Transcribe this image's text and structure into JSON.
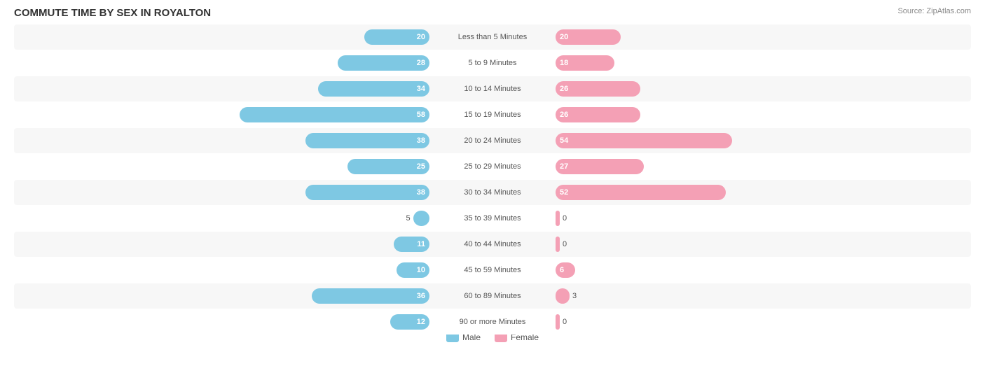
{
  "title": "COMMUTE TIME BY SEX IN ROYALTON",
  "source": "Source: ZipAtlas.com",
  "colors": {
    "male": "#7ec8e3",
    "female": "#f4a0b5"
  },
  "legend": {
    "male": "Male",
    "female": "Female"
  },
  "axis": {
    "left": "60",
    "right": "60"
  },
  "rows": [
    {
      "label": "Less than 5 Minutes",
      "male": 20,
      "female": 20,
      "male_pct": 62,
      "female_pct": 62
    },
    {
      "label": "5 to 9 Minutes",
      "male": 28,
      "female": 18,
      "male_pct": 87,
      "female_pct": 56
    },
    {
      "label": "10 to 14 Minutes",
      "male": 34,
      "female": 26,
      "male_pct": 106,
      "female_pct": 81
    },
    {
      "label": "15 to 19 Minutes",
      "male": 58,
      "female": 26,
      "male_pct": 180,
      "female_pct": 81
    },
    {
      "label": "20 to 24 Minutes",
      "male": 38,
      "female": 54,
      "male_pct": 118,
      "female_pct": 168
    },
    {
      "label": "25 to 29 Minutes",
      "male": 25,
      "female": 27,
      "male_pct": 78,
      "female_pct": 84
    },
    {
      "label": "30 to 34 Minutes",
      "male": 38,
      "female": 52,
      "male_pct": 118,
      "female_pct": 162
    },
    {
      "label": "35 to 39 Minutes",
      "male": 5,
      "female": 0,
      "male_pct": 16,
      "female_pct": 0
    },
    {
      "label": "40 to 44 Minutes",
      "male": 11,
      "female": 0,
      "male_pct": 34,
      "female_pct": 0
    },
    {
      "label": "45 to 59 Minutes",
      "male": 10,
      "female": 6,
      "male_pct": 31,
      "female_pct": 19
    },
    {
      "label": "60 to 89 Minutes",
      "male": 36,
      "female": 3,
      "male_pct": 112,
      "female_pct": 9
    },
    {
      "label": "90 or more Minutes",
      "male": 12,
      "female": 0,
      "male_pct": 37,
      "female_pct": 0
    }
  ]
}
